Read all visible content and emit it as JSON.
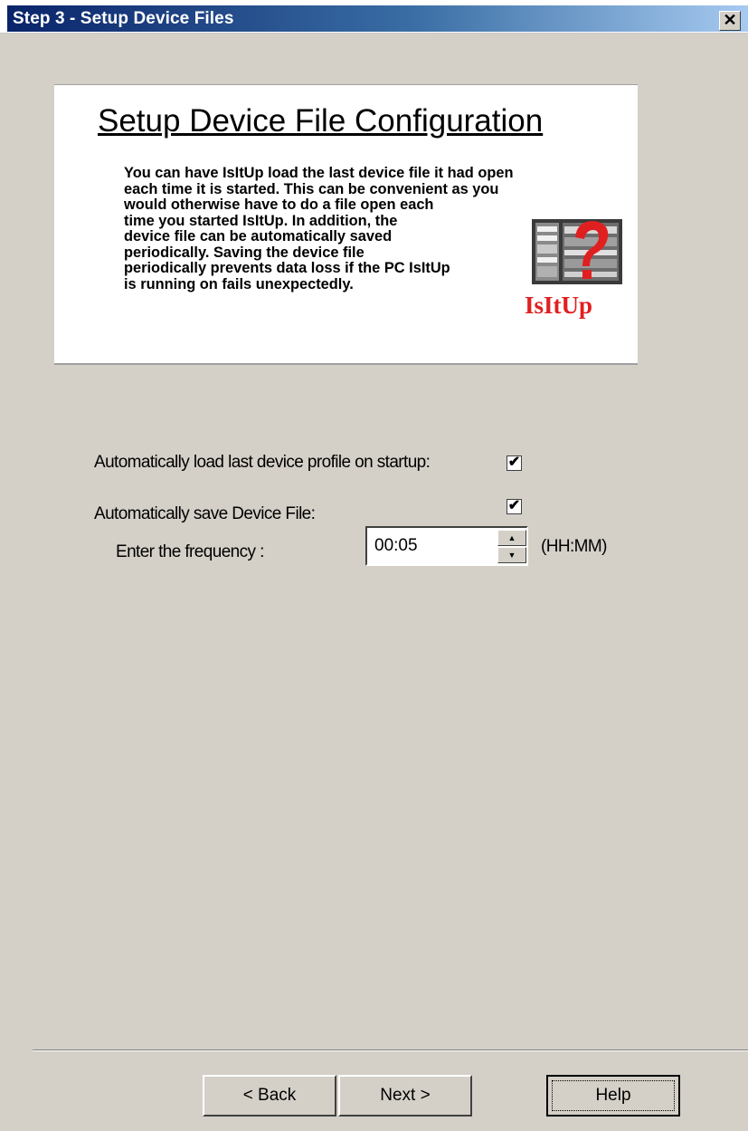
{
  "window": {
    "title": "Step 3 - Setup Device Files",
    "close_glyph": "✕"
  },
  "intro": {
    "heading": "Setup Device File Configuration",
    "lines": [
      "You can have IsItUp load the last device file it had open",
      "each time it is started.  This can be convenient as you",
      "would otherwise have to do a file open each",
      "time you started IsItUp.  In addition, the",
      "device file can be automatically saved",
      "periodically.  Saving the device file",
      "periodically prevents data loss if the PC IsItUp",
      "is running on fails unexpectedly."
    ],
    "logo_text": "IsItUp",
    "logo_icon": "server-rack-question-icon"
  },
  "options": {
    "auto_load_label": "Automatically load last device profile on startup:",
    "auto_load_checked": true,
    "auto_save_label": "Automatically save Device File:",
    "auto_save_checked": true,
    "frequency_label": "Enter the frequency :",
    "frequency_value": "00:05",
    "frequency_unit": "(HH:MM)",
    "check_glyph": "✔",
    "spin_up_glyph": "▲",
    "spin_down_glyph": "▼"
  },
  "buttons": {
    "back": "< Back",
    "next": "Next >",
    "help": "Help"
  },
  "colors": {
    "titlebar_start": "#0a246a",
    "titlebar_end": "#a6caf0",
    "dialog_bg": "#d4d0c8",
    "logo_red": "#e02020"
  }
}
